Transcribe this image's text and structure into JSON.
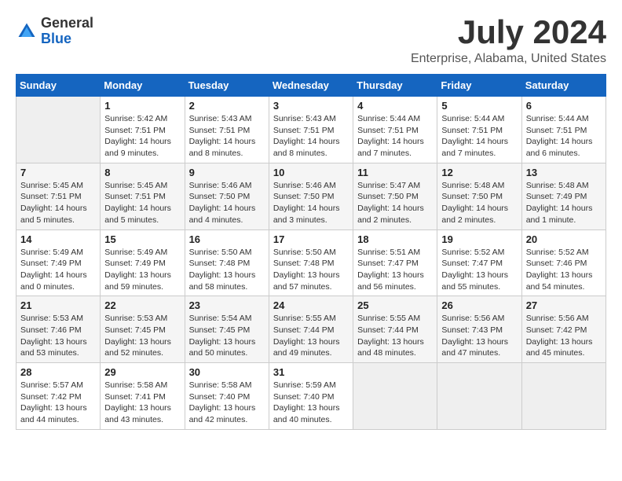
{
  "header": {
    "logo": {
      "general": "General",
      "blue": "Blue"
    },
    "title": "July 2024",
    "location": "Enterprise, Alabama, United States"
  },
  "columns": [
    "Sunday",
    "Monday",
    "Tuesday",
    "Wednesday",
    "Thursday",
    "Friday",
    "Saturday"
  ],
  "weeks": [
    [
      {
        "num": "",
        "empty": true
      },
      {
        "num": "1",
        "sunrise": "Sunrise: 5:42 AM",
        "sunset": "Sunset: 7:51 PM",
        "daylight": "Daylight: 14 hours and 9 minutes."
      },
      {
        "num": "2",
        "sunrise": "Sunrise: 5:43 AM",
        "sunset": "Sunset: 7:51 PM",
        "daylight": "Daylight: 14 hours and 8 minutes."
      },
      {
        "num": "3",
        "sunrise": "Sunrise: 5:43 AM",
        "sunset": "Sunset: 7:51 PM",
        "daylight": "Daylight: 14 hours and 8 minutes."
      },
      {
        "num": "4",
        "sunrise": "Sunrise: 5:44 AM",
        "sunset": "Sunset: 7:51 PM",
        "daylight": "Daylight: 14 hours and 7 minutes."
      },
      {
        "num": "5",
        "sunrise": "Sunrise: 5:44 AM",
        "sunset": "Sunset: 7:51 PM",
        "daylight": "Daylight: 14 hours and 7 minutes."
      },
      {
        "num": "6",
        "sunrise": "Sunrise: 5:44 AM",
        "sunset": "Sunset: 7:51 PM",
        "daylight": "Daylight: 14 hours and 6 minutes."
      }
    ],
    [
      {
        "num": "7",
        "sunrise": "Sunrise: 5:45 AM",
        "sunset": "Sunset: 7:51 PM",
        "daylight": "Daylight: 14 hours and 5 minutes."
      },
      {
        "num": "8",
        "sunrise": "Sunrise: 5:45 AM",
        "sunset": "Sunset: 7:51 PM",
        "daylight": "Daylight: 14 hours and 5 minutes."
      },
      {
        "num": "9",
        "sunrise": "Sunrise: 5:46 AM",
        "sunset": "Sunset: 7:50 PM",
        "daylight": "Daylight: 14 hours and 4 minutes."
      },
      {
        "num": "10",
        "sunrise": "Sunrise: 5:46 AM",
        "sunset": "Sunset: 7:50 PM",
        "daylight": "Daylight: 14 hours and 3 minutes."
      },
      {
        "num": "11",
        "sunrise": "Sunrise: 5:47 AM",
        "sunset": "Sunset: 7:50 PM",
        "daylight": "Daylight: 14 hours and 2 minutes."
      },
      {
        "num": "12",
        "sunrise": "Sunrise: 5:48 AM",
        "sunset": "Sunset: 7:50 PM",
        "daylight": "Daylight: 14 hours and 2 minutes."
      },
      {
        "num": "13",
        "sunrise": "Sunrise: 5:48 AM",
        "sunset": "Sunset: 7:49 PM",
        "daylight": "Daylight: 14 hours and 1 minute."
      }
    ],
    [
      {
        "num": "14",
        "sunrise": "Sunrise: 5:49 AM",
        "sunset": "Sunset: 7:49 PM",
        "daylight": "Daylight: 14 hours and 0 minutes."
      },
      {
        "num": "15",
        "sunrise": "Sunrise: 5:49 AM",
        "sunset": "Sunset: 7:49 PM",
        "daylight": "Daylight: 13 hours and 59 minutes."
      },
      {
        "num": "16",
        "sunrise": "Sunrise: 5:50 AM",
        "sunset": "Sunset: 7:48 PM",
        "daylight": "Daylight: 13 hours and 58 minutes."
      },
      {
        "num": "17",
        "sunrise": "Sunrise: 5:50 AM",
        "sunset": "Sunset: 7:48 PM",
        "daylight": "Daylight: 13 hours and 57 minutes."
      },
      {
        "num": "18",
        "sunrise": "Sunrise: 5:51 AM",
        "sunset": "Sunset: 7:47 PM",
        "daylight": "Daylight: 13 hours and 56 minutes."
      },
      {
        "num": "19",
        "sunrise": "Sunrise: 5:52 AM",
        "sunset": "Sunset: 7:47 PM",
        "daylight": "Daylight: 13 hours and 55 minutes."
      },
      {
        "num": "20",
        "sunrise": "Sunrise: 5:52 AM",
        "sunset": "Sunset: 7:46 PM",
        "daylight": "Daylight: 13 hours and 54 minutes."
      }
    ],
    [
      {
        "num": "21",
        "sunrise": "Sunrise: 5:53 AM",
        "sunset": "Sunset: 7:46 PM",
        "daylight": "Daylight: 13 hours and 53 minutes."
      },
      {
        "num": "22",
        "sunrise": "Sunrise: 5:53 AM",
        "sunset": "Sunset: 7:45 PM",
        "daylight": "Daylight: 13 hours and 52 minutes."
      },
      {
        "num": "23",
        "sunrise": "Sunrise: 5:54 AM",
        "sunset": "Sunset: 7:45 PM",
        "daylight": "Daylight: 13 hours and 50 minutes."
      },
      {
        "num": "24",
        "sunrise": "Sunrise: 5:55 AM",
        "sunset": "Sunset: 7:44 PM",
        "daylight": "Daylight: 13 hours and 49 minutes."
      },
      {
        "num": "25",
        "sunrise": "Sunrise: 5:55 AM",
        "sunset": "Sunset: 7:44 PM",
        "daylight": "Daylight: 13 hours and 48 minutes."
      },
      {
        "num": "26",
        "sunrise": "Sunrise: 5:56 AM",
        "sunset": "Sunset: 7:43 PM",
        "daylight": "Daylight: 13 hours and 47 minutes."
      },
      {
        "num": "27",
        "sunrise": "Sunrise: 5:56 AM",
        "sunset": "Sunset: 7:42 PM",
        "daylight": "Daylight: 13 hours and 45 minutes."
      }
    ],
    [
      {
        "num": "28",
        "sunrise": "Sunrise: 5:57 AM",
        "sunset": "Sunset: 7:42 PM",
        "daylight": "Daylight: 13 hours and 44 minutes."
      },
      {
        "num": "29",
        "sunrise": "Sunrise: 5:58 AM",
        "sunset": "Sunset: 7:41 PM",
        "daylight": "Daylight: 13 hours and 43 minutes."
      },
      {
        "num": "30",
        "sunrise": "Sunrise: 5:58 AM",
        "sunset": "Sunset: 7:40 PM",
        "daylight": "Daylight: 13 hours and 42 minutes."
      },
      {
        "num": "31",
        "sunrise": "Sunrise: 5:59 AM",
        "sunset": "Sunset: 7:40 PM",
        "daylight": "Daylight: 13 hours and 40 minutes."
      },
      {
        "num": "",
        "empty": true
      },
      {
        "num": "",
        "empty": true
      },
      {
        "num": "",
        "empty": true
      }
    ]
  ]
}
